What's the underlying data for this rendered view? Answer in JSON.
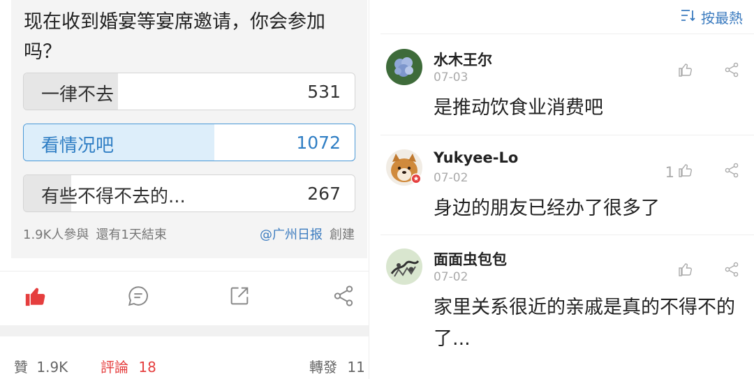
{
  "poll": {
    "question": "现在收到婚宴等宴席邀请，你会参加吗？",
    "options": [
      {
        "label": "一律不去",
        "count": "531",
        "share": 0.285
      },
      {
        "label": "看情况吧",
        "count": "1072",
        "share": 0.575,
        "selected": true
      },
      {
        "label": "有些不得不去的...",
        "count": "267",
        "share": 0.143
      }
    ],
    "participants": "1.9K人參與",
    "remaining": "還有1天結束",
    "source": "@广州日报",
    "created": "創建"
  },
  "actions": {
    "icons": [
      "thumbs-up-icon",
      "comment-icon",
      "external-share-icon",
      "share-icon"
    ],
    "like_color": "#e53e3e"
  },
  "stats": {
    "likes_label": "贊",
    "likes_value": "1.9K",
    "comments_label": "評論",
    "comments_value": "18",
    "reposts_label": "轉發",
    "reposts_value": "11"
  },
  "sort": {
    "icon": "sort-icon",
    "label": "按最熱"
  },
  "comments": [
    {
      "name": "水木王尔",
      "date": "07-03",
      "text": "是推动饮食业消费吧",
      "likes": ""
    },
    {
      "name": "Yukyee-Lo",
      "date": "07-02",
      "text": "身边的朋友已经办了很多了",
      "likes": "1"
    },
    {
      "name": "面面虫包包",
      "date": "07-02",
      "text": "家里关系很近的亲戚是真的不得不的了...",
      "likes": ""
    }
  ]
}
